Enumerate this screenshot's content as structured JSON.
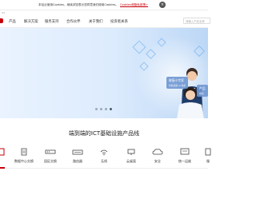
{
  "cookie": {
    "text": "本站点使用Cookies，继续浏览表示您同意我们使用Cookies。",
    "link": "Cookies和隐私政策>",
    "close": "×"
  },
  "top_strip": "US",
  "nav": {
    "items": [
      "产品",
      "解决方案",
      "服务支持",
      "合作伙伴",
      "关于我们",
      "投资者关系"
    ],
    "search_placeholder": "请输入产品名称"
  },
  "hero": {
    "card1_title": "联接小专家",
    "card1_sub": "智能运维 AI 助手",
    "card2_title": "产品",
    "card2_sub": "规划",
    "carousel_count": 4,
    "active_dot": 3
  },
  "section": {
    "title": "端到端的ICT基础设施产品线",
    "categories": [
      "",
      "数据中心交换",
      "园区交换",
      "路由器",
      "无线",
      "云桌面",
      "安全",
      "统一运维",
      "服"
    ]
  },
  "colors": {
    "brand": "#c7000b"
  }
}
